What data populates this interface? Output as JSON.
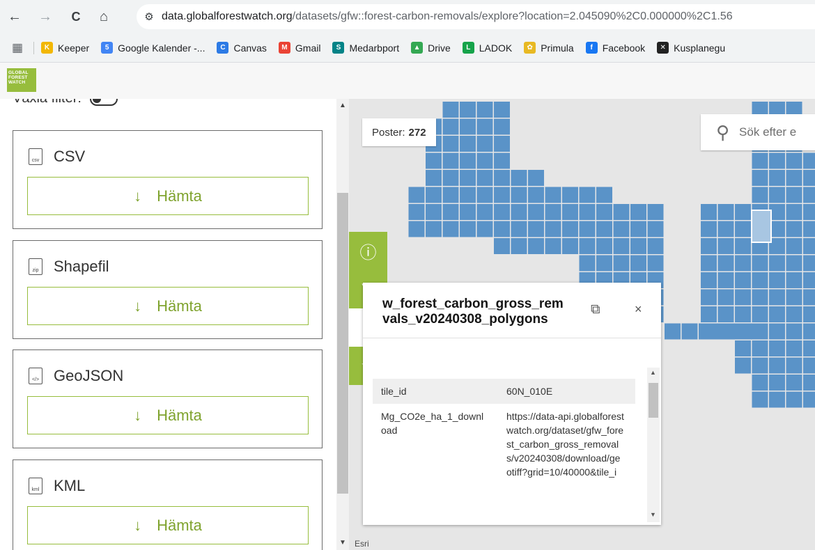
{
  "browser": {
    "back_icon": "←",
    "forward_icon": "→",
    "reload_icon": "C",
    "home_icon": "⌂",
    "site_info_icon": "⚙",
    "url_host": "data.globalforestwatch.org",
    "url_path": "/datasets/gfw::forest-carbon-removals/explore?location=2.045090%2C0.000000%2C1.56"
  },
  "bookmarks": [
    {
      "label": "Keeper",
      "color": "#f2b705",
      "glyph": "K"
    },
    {
      "label": "Google Kalender -...",
      "color": "#4285f4",
      "glyph": "5"
    },
    {
      "label": "Canvas",
      "color": "#2d7be5",
      "glyph": "C"
    },
    {
      "label": "Gmail",
      "color": "#ea4335",
      "glyph": "M"
    },
    {
      "label": "Medarbport",
      "color": "#038387",
      "glyph": "S"
    },
    {
      "label": "Drive",
      "color": "#34a853",
      "glyph": "▲"
    },
    {
      "label": "LADOK",
      "color": "#16a34a",
      "glyph": "L"
    },
    {
      "label": "Primula",
      "color": "#e8b923",
      "glyph": "✿"
    },
    {
      "label": "Facebook",
      "color": "#1877f2",
      "glyph": "f"
    },
    {
      "label": "Kusplanegu",
      "color": "#222222",
      "glyph": "✕"
    }
  ],
  "logo": {
    "line1": "GLOBAL",
    "line2": "FOREST",
    "line3": "WATCH"
  },
  "panel": {
    "filter_label": "Växla filter:",
    "formats": [
      {
        "name": "CSV",
        "file_icon": "csv",
        "button": "Hämta"
      },
      {
        "name": "Shapefil",
        "file_icon": "zip",
        "button": "Hämta"
      },
      {
        "name": "GeoJSON",
        "file_icon": "</>",
        "button": "Hämta"
      },
      {
        "name": "KML",
        "file_icon": "kml",
        "button": "Hämta"
      }
    ],
    "download_arrow": "↓"
  },
  "map": {
    "records_label": "Poster:",
    "records_count": "272",
    "search_placeholder": "Sök efter e",
    "attribution": "Esri",
    "tile_color": "#5a93c8",
    "tile_selected_color": "#a8c6e2"
  },
  "tools": {
    "info_icon": "ⓘ",
    "filter_icon": "▽",
    "download_icon": "⇩",
    "favorite_icon": "☆"
  },
  "popup": {
    "title": "w_forest_carbon_gross_rem vals_v20240308_polygons",
    "dock_icon": "⧉",
    "close_icon": "×",
    "rows": [
      {
        "key": "tile_id",
        "value": "60N_010E"
      },
      {
        "key": "Mg_CO2e_ha_1_download",
        "value": "https://data-api.globalforestwatch.org/dataset/gfw_forest_carbon_gross_removals/v20240308/download/geotiff?grid=10/40000&tile_i"
      }
    ]
  }
}
